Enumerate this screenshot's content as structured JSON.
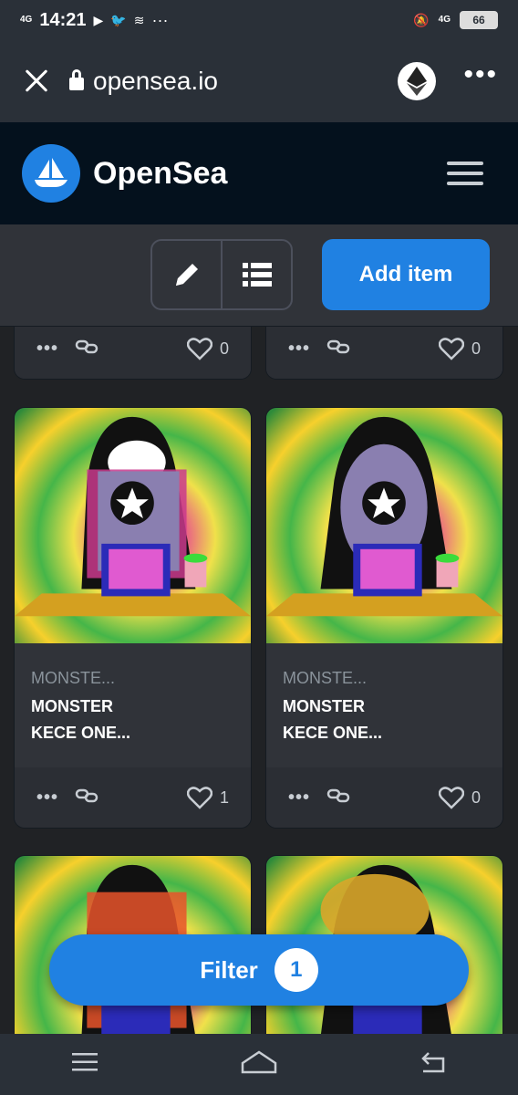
{
  "status_bar": {
    "network_left": "4G",
    "time": "14:21",
    "more": "···",
    "network_right": "4G",
    "battery": "66"
  },
  "browser": {
    "url": "opensea.io"
  },
  "header": {
    "brand": "OpenSea"
  },
  "toolbar": {
    "add_item_label": "Add item"
  },
  "top_cards": [
    {
      "likes": "0"
    },
    {
      "likes": "0"
    }
  ],
  "cards": [
    {
      "collection": "MONSTE...",
      "title_line1": "MONSTER",
      "title_line2": "KECE ONE...",
      "likes": "1"
    },
    {
      "collection": "MONSTE...",
      "title_line1": "MONSTER",
      "title_line2": "KECE ONE...",
      "likes": "0"
    }
  ],
  "filter": {
    "label": "Filter",
    "count": "1"
  },
  "colors": {
    "accent": "#2081e2",
    "header_bg": "#04111d",
    "card_bg": "#303339"
  }
}
